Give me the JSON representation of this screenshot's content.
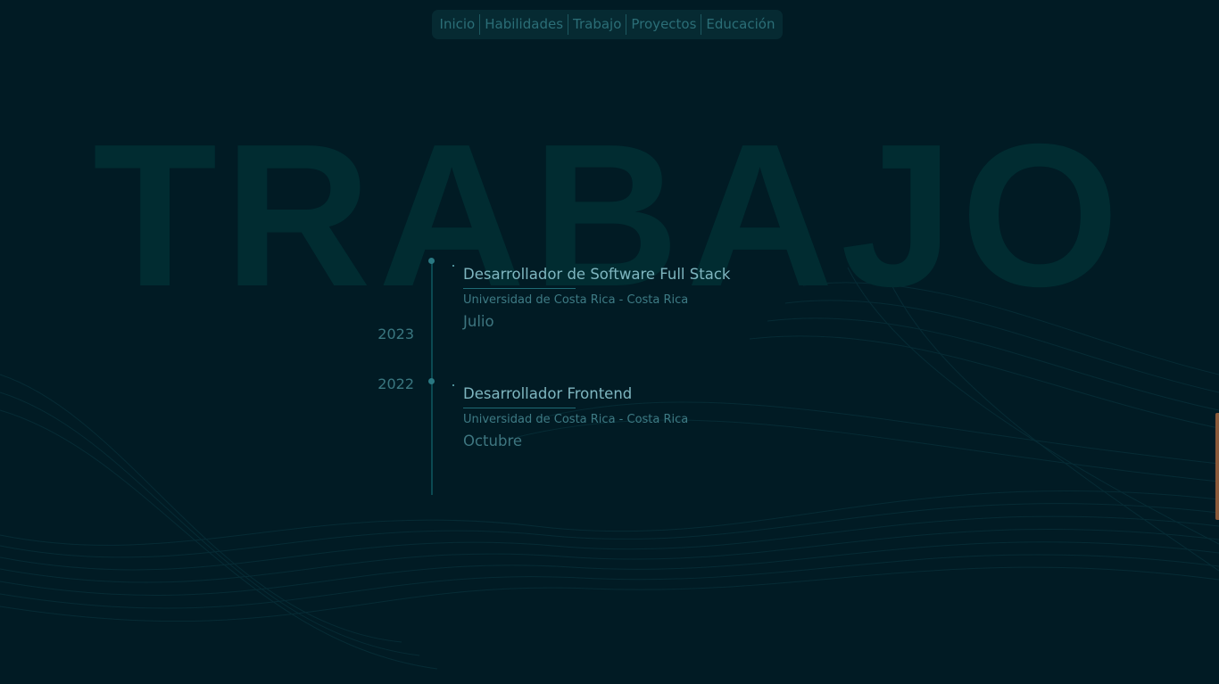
{
  "nav": {
    "items": [
      {
        "label": "Inicio"
      },
      {
        "label": "Habilidades"
      },
      {
        "label": "Trabajo"
      },
      {
        "label": "Proyectos"
      },
      {
        "label": "Educación"
      }
    ]
  },
  "section": {
    "title": "TRABAJO"
  },
  "timeline": {
    "years": [
      "2023",
      "2022"
    ],
    "jobs": [
      {
        "title": "Desarrollador de Software Full Stack",
        "company": "Universidad de Costa Rica - Costa Rica",
        "month": "Julio"
      },
      {
        "title": "Desarrollador Frontend",
        "company": "Universidad de Costa Rica - Costa Rica",
        "month": "Octubre"
      }
    ]
  },
  "colors": {
    "background": "#011b24",
    "accent": "#7fb6c0",
    "muted": "#3e7b85",
    "scroll_indicator": "#8a5a3a"
  }
}
